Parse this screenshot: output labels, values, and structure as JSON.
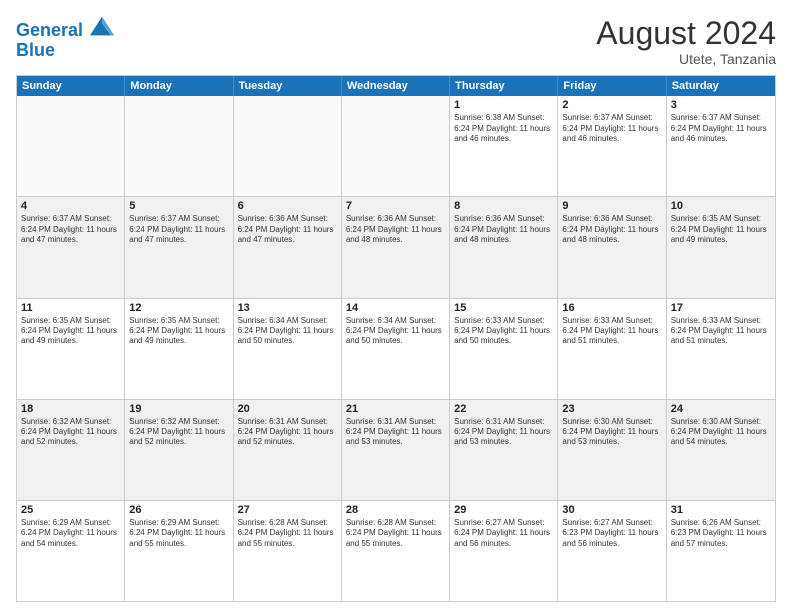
{
  "logo": {
    "line1": "General",
    "line2": "Blue"
  },
  "title": "August 2024",
  "location": "Utete, Tanzania",
  "days": [
    "Sunday",
    "Monday",
    "Tuesday",
    "Wednesday",
    "Thursday",
    "Friday",
    "Saturday"
  ],
  "rows": [
    [
      {
        "day": "",
        "info": ""
      },
      {
        "day": "",
        "info": ""
      },
      {
        "day": "",
        "info": ""
      },
      {
        "day": "",
        "info": ""
      },
      {
        "day": "1",
        "info": "Sunrise: 6:38 AM\nSunset: 6:24 PM\nDaylight: 11 hours\nand 46 minutes."
      },
      {
        "day": "2",
        "info": "Sunrise: 6:37 AM\nSunset: 6:24 PM\nDaylight: 11 hours\nand 46 minutes."
      },
      {
        "day": "3",
        "info": "Sunrise: 6:37 AM\nSunset: 6:24 PM\nDaylight: 11 hours\nand 46 minutes."
      }
    ],
    [
      {
        "day": "4",
        "info": "Sunrise: 6:37 AM\nSunset: 6:24 PM\nDaylight: 11 hours\nand 47 minutes."
      },
      {
        "day": "5",
        "info": "Sunrise: 6:37 AM\nSunset: 6:24 PM\nDaylight: 11 hours\nand 47 minutes."
      },
      {
        "day": "6",
        "info": "Sunrise: 6:36 AM\nSunset: 6:24 PM\nDaylight: 11 hours\nand 47 minutes."
      },
      {
        "day": "7",
        "info": "Sunrise: 6:36 AM\nSunset: 6:24 PM\nDaylight: 11 hours\nand 48 minutes."
      },
      {
        "day": "8",
        "info": "Sunrise: 6:36 AM\nSunset: 6:24 PM\nDaylight: 11 hours\nand 48 minutes."
      },
      {
        "day": "9",
        "info": "Sunrise: 6:36 AM\nSunset: 6:24 PM\nDaylight: 11 hours\nand 48 minutes."
      },
      {
        "day": "10",
        "info": "Sunrise: 6:35 AM\nSunset: 6:24 PM\nDaylight: 11 hours\nand 49 minutes."
      }
    ],
    [
      {
        "day": "11",
        "info": "Sunrise: 6:35 AM\nSunset: 6:24 PM\nDaylight: 11 hours\nand 49 minutes."
      },
      {
        "day": "12",
        "info": "Sunrise: 6:35 AM\nSunset: 6:24 PM\nDaylight: 11 hours\nand 49 minutes."
      },
      {
        "day": "13",
        "info": "Sunrise: 6:34 AM\nSunset: 6:24 PM\nDaylight: 11 hours\nand 50 minutes."
      },
      {
        "day": "14",
        "info": "Sunrise: 6:34 AM\nSunset: 6:24 PM\nDaylight: 11 hours\nand 50 minutes."
      },
      {
        "day": "15",
        "info": "Sunrise: 6:33 AM\nSunset: 6:24 PM\nDaylight: 11 hours\nand 50 minutes."
      },
      {
        "day": "16",
        "info": "Sunrise: 6:33 AM\nSunset: 6:24 PM\nDaylight: 11 hours\nand 51 minutes."
      },
      {
        "day": "17",
        "info": "Sunrise: 6:33 AM\nSunset: 6:24 PM\nDaylight: 11 hours\nand 51 minutes."
      }
    ],
    [
      {
        "day": "18",
        "info": "Sunrise: 6:32 AM\nSunset: 6:24 PM\nDaylight: 11 hours\nand 52 minutes."
      },
      {
        "day": "19",
        "info": "Sunrise: 6:32 AM\nSunset: 6:24 PM\nDaylight: 11 hours\nand 52 minutes."
      },
      {
        "day": "20",
        "info": "Sunrise: 6:31 AM\nSunset: 6:24 PM\nDaylight: 11 hours\nand 52 minutes."
      },
      {
        "day": "21",
        "info": "Sunrise: 6:31 AM\nSunset: 6:24 PM\nDaylight: 11 hours\nand 53 minutes."
      },
      {
        "day": "22",
        "info": "Sunrise: 6:31 AM\nSunset: 6:24 PM\nDaylight: 11 hours\nand 53 minutes."
      },
      {
        "day": "23",
        "info": "Sunrise: 6:30 AM\nSunset: 6:24 PM\nDaylight: 11 hours\nand 53 minutes."
      },
      {
        "day": "24",
        "info": "Sunrise: 6:30 AM\nSunset: 6:24 PM\nDaylight: 11 hours\nand 54 minutes."
      }
    ],
    [
      {
        "day": "25",
        "info": "Sunrise: 6:29 AM\nSunset: 6:24 PM\nDaylight: 11 hours\nand 54 minutes."
      },
      {
        "day": "26",
        "info": "Sunrise: 6:29 AM\nSunset: 6:24 PM\nDaylight: 11 hours\nand 55 minutes."
      },
      {
        "day": "27",
        "info": "Sunrise: 6:28 AM\nSunset: 6:24 PM\nDaylight: 11 hours\nand 55 minutes."
      },
      {
        "day": "28",
        "info": "Sunrise: 6:28 AM\nSunset: 6:24 PM\nDaylight: 11 hours\nand 55 minutes."
      },
      {
        "day": "29",
        "info": "Sunrise: 6:27 AM\nSunset: 6:24 PM\nDaylight: 11 hours\nand 56 minutes."
      },
      {
        "day": "30",
        "info": "Sunrise: 6:27 AM\nSunset: 6:23 PM\nDaylight: 11 hours\nand 56 minutes."
      },
      {
        "day": "31",
        "info": "Sunrise: 6:26 AM\nSunset: 6:23 PM\nDaylight: 11 hours\nand 57 minutes."
      }
    ]
  ]
}
